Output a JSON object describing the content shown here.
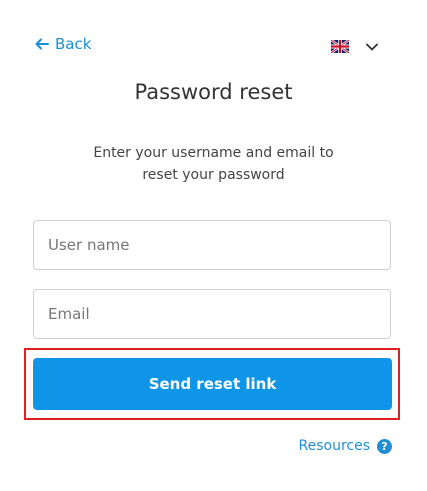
{
  "nav": {
    "back_label": "Back"
  },
  "language": {
    "selected": "English (UK)",
    "flag_icon": "uk-flag-icon"
  },
  "header": {
    "title": "Password reset",
    "subtitle": "Enter your username and email to reset your password"
  },
  "form": {
    "username_placeholder": "User name",
    "username_value": "",
    "email_placeholder": "Email",
    "email_value": "",
    "submit_label": "Send reset link"
  },
  "footer": {
    "resources_label": "Resources",
    "help_icon": "?"
  },
  "colors": {
    "accent": "#1e8fd6",
    "button": "#0e95e8",
    "highlight": "#e02020"
  }
}
